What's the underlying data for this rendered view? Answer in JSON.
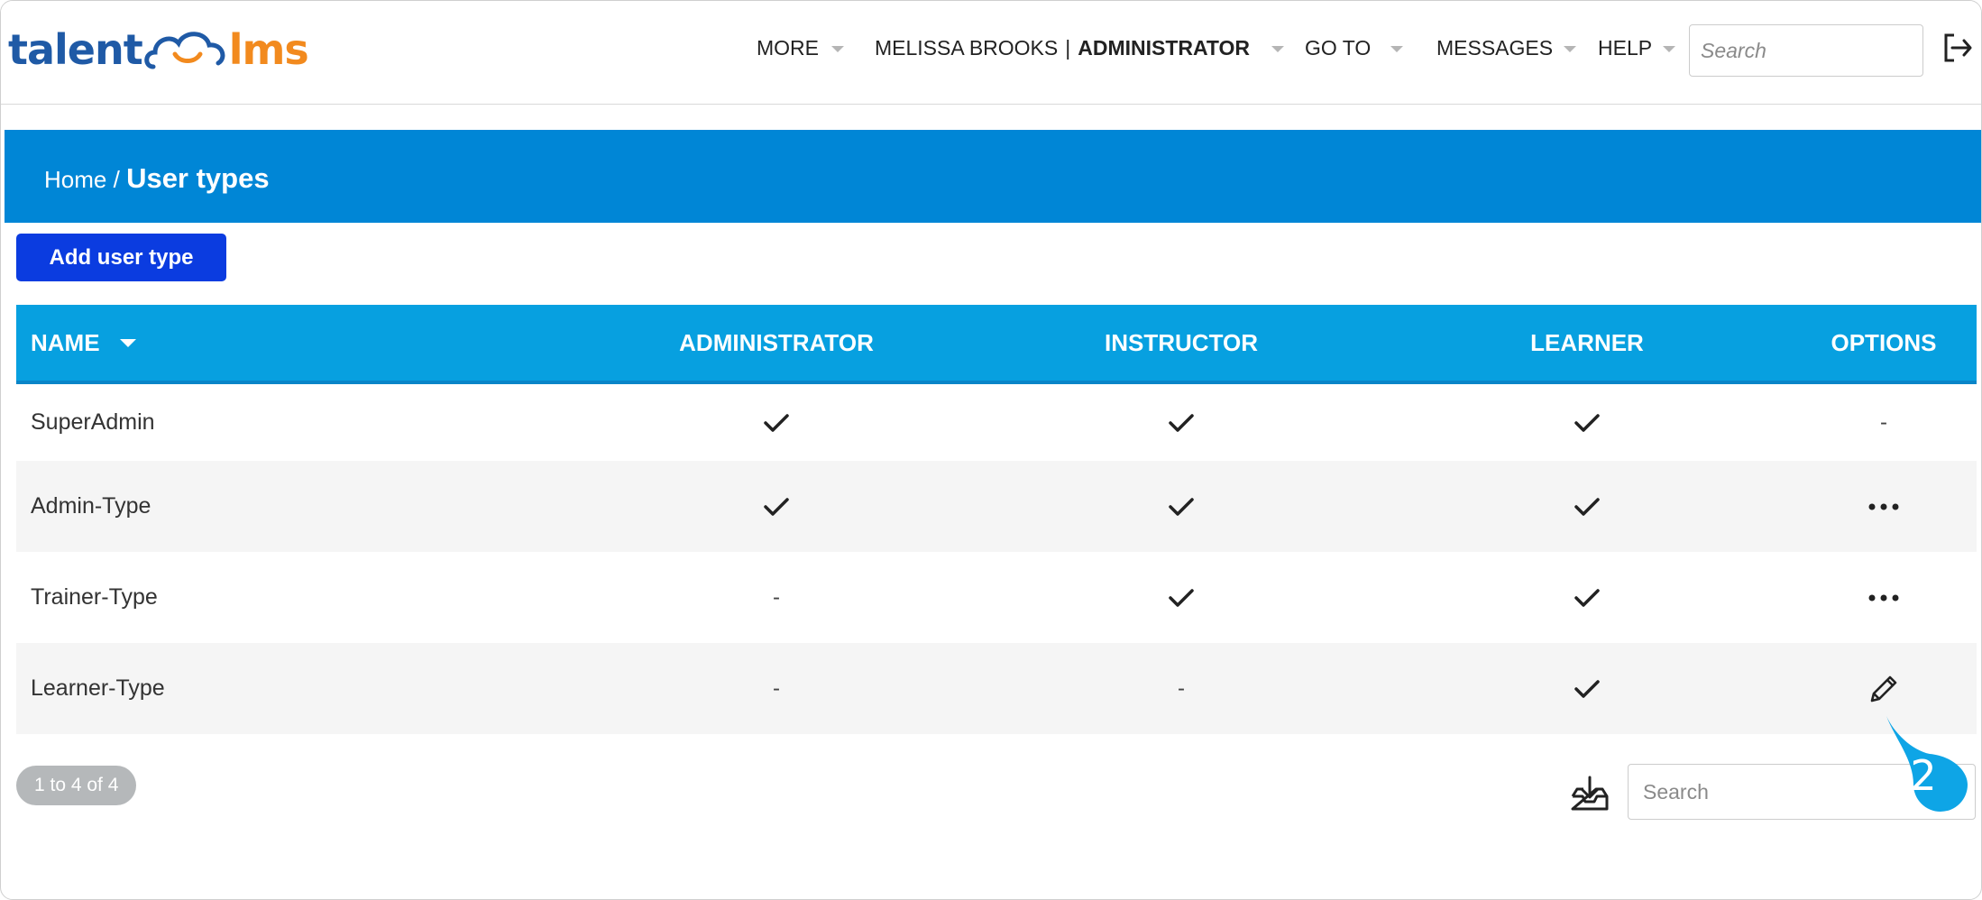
{
  "header": {
    "logo_left": "talent",
    "logo_right": "lms",
    "nav": {
      "more": "MORE",
      "user_name": "MELISSA BROOKS",
      "separator": "|",
      "user_role": "ADMINISTRATOR",
      "goto": "GO TO",
      "messages": "MESSAGES",
      "help": "HELP"
    },
    "search_placeholder": "Search",
    "logout_icon": "logout-icon"
  },
  "breadcrumb": {
    "home": "Home",
    "separator": "/",
    "current": "User types"
  },
  "toolbar": {
    "add_label": "Add user type"
  },
  "table": {
    "columns": {
      "name": "NAME",
      "administrator": "ADMINISTRATOR",
      "instructor": "INSTRUCTOR",
      "learner": "LEARNER",
      "options": "OPTIONS"
    },
    "rows": [
      {
        "name": "SuperAdmin",
        "administrator": true,
        "instructor": true,
        "learner": true,
        "options": "-"
      },
      {
        "name": "Admin-Type",
        "administrator": true,
        "instructor": true,
        "learner": true,
        "options": "more-icon"
      },
      {
        "name": "Trainer-Type",
        "administrator": false,
        "instructor": true,
        "learner": true,
        "options": "more-icon"
      },
      {
        "name": "Learner-Type",
        "administrator": false,
        "instructor": false,
        "learner": true,
        "options": "pencil-icon"
      }
    ],
    "empty_mark": "-"
  },
  "footer": {
    "count": "1 to 4 of 4",
    "search_placeholder": "Search",
    "export_icon": "export-icon"
  },
  "step_badge": {
    "number": "2",
    "color": "#0ea5e6"
  },
  "colors": {
    "banner": "#0086d6",
    "table_header": "#07a0e0",
    "add_button": "#0b3ce0",
    "logo_blue": "#1f5aa6",
    "logo_orange": "#f28a1e"
  }
}
